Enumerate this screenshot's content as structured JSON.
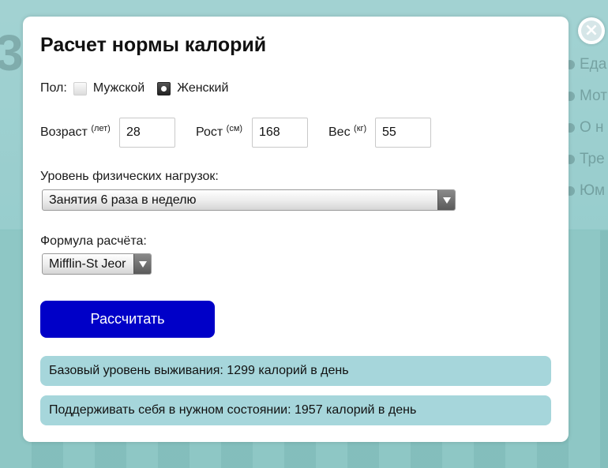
{
  "background": {
    "big_digit": "3",
    "side_items": [
      "Еда",
      "Мот",
      "О н",
      "Тре",
      "Юм"
    ]
  },
  "modal": {
    "title": "Расчет нормы калорий",
    "close_glyph": "×",
    "gender": {
      "label": "Пол:",
      "options": [
        {
          "label": "Мужской",
          "checked": false
        },
        {
          "label": "Женский",
          "checked": true
        }
      ]
    },
    "params": {
      "age": {
        "label": "Возраст",
        "unit": "(лет)",
        "value": "28"
      },
      "height": {
        "label": "Рост",
        "unit": "(см)",
        "value": "168"
      },
      "weight": {
        "label": "Вес",
        "unit": "(кг)",
        "value": "55"
      }
    },
    "activity": {
      "label": "Уровень физических нагрузок:",
      "selected": "Занятия 6 раза в неделю"
    },
    "formula": {
      "label": "Формула расчёта:",
      "selected": "Mifflin-St Jeor"
    },
    "calculate_label": "Рассчитать",
    "results": {
      "basal": "Базовый уровень выживания: 1299 калорий в день",
      "maintain": "Поддерживать себя в нужном состоянии: 1957 калорий в день"
    }
  },
  "colors": {
    "button": "#0000c8",
    "result_bg": "#a6d6db",
    "page_bg": "#9fcfcf"
  }
}
